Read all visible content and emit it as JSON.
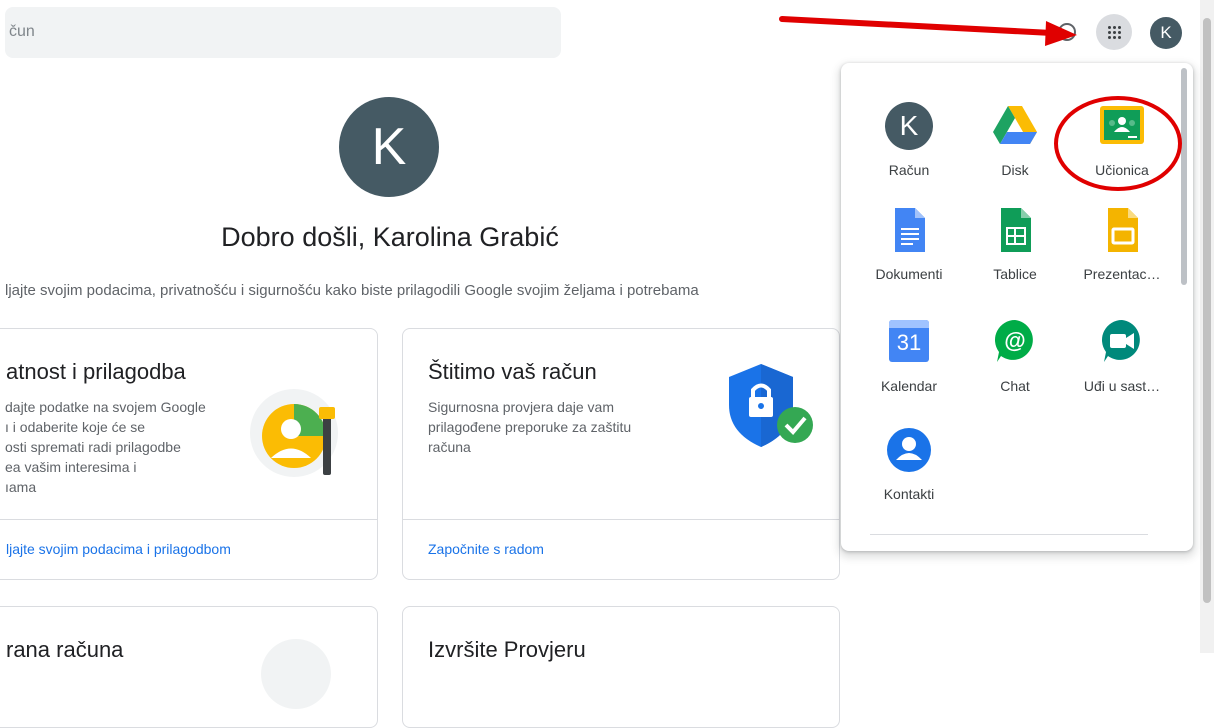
{
  "search": {
    "text": "čun"
  },
  "header": {
    "avatar_letter": "K"
  },
  "hero": {
    "avatar_letter": "K",
    "title": "Dobro došli, Karolina Grabić",
    "subtitle": "ljajte svojim podacima, privatnošću i sigurnošću kako biste prilagodili Google svojim željama i potrebama"
  },
  "cards": {
    "privacy": {
      "title": "atnost i prilagodba",
      "lines": [
        "dajte podatke na svojem Google",
        "ı i odaberite koje će se",
        "osti spremati radi prilagodbe",
        "ea vašim interesima i",
        "ıama"
      ],
      "link": "ljajte svojim podacima i prilagodbom"
    },
    "security": {
      "title": "Štitimo vaš račun",
      "lines": [
        "Sigurnosna provjera daje vam",
        "prilagođene preporuke za zaštitu",
        "računa"
      ],
      "link": "Započnite s radom"
    },
    "bottom_left": {
      "title": "rana računa"
    },
    "bottom_right": {
      "title": "Izvršite Provjeru"
    }
  },
  "apps": {
    "items": [
      {
        "label": "Račun",
        "icon": "account-icon"
      },
      {
        "label": "Disk",
        "icon": "drive-icon"
      },
      {
        "label": "Učionica",
        "icon": "classroom-icon"
      },
      {
        "label": "Dokumenti",
        "icon": "docs-icon"
      },
      {
        "label": "Tablice",
        "icon": "sheets-icon"
      },
      {
        "label": "Prezentac…",
        "icon": "slides-icon"
      },
      {
        "label": "Kalendar",
        "icon": "calendar-icon",
        "badge": "31"
      },
      {
        "label": "Chat",
        "icon": "chat-icon"
      },
      {
        "label": "Uđi u sast…",
        "icon": "meet-icon"
      },
      {
        "label": "Kontakti",
        "icon": "contacts-icon"
      }
    ],
    "account_letter": "K"
  },
  "colors": {
    "accent": "#1a73e8",
    "annotation_red": "#e00000",
    "avatar": "#455a64"
  }
}
